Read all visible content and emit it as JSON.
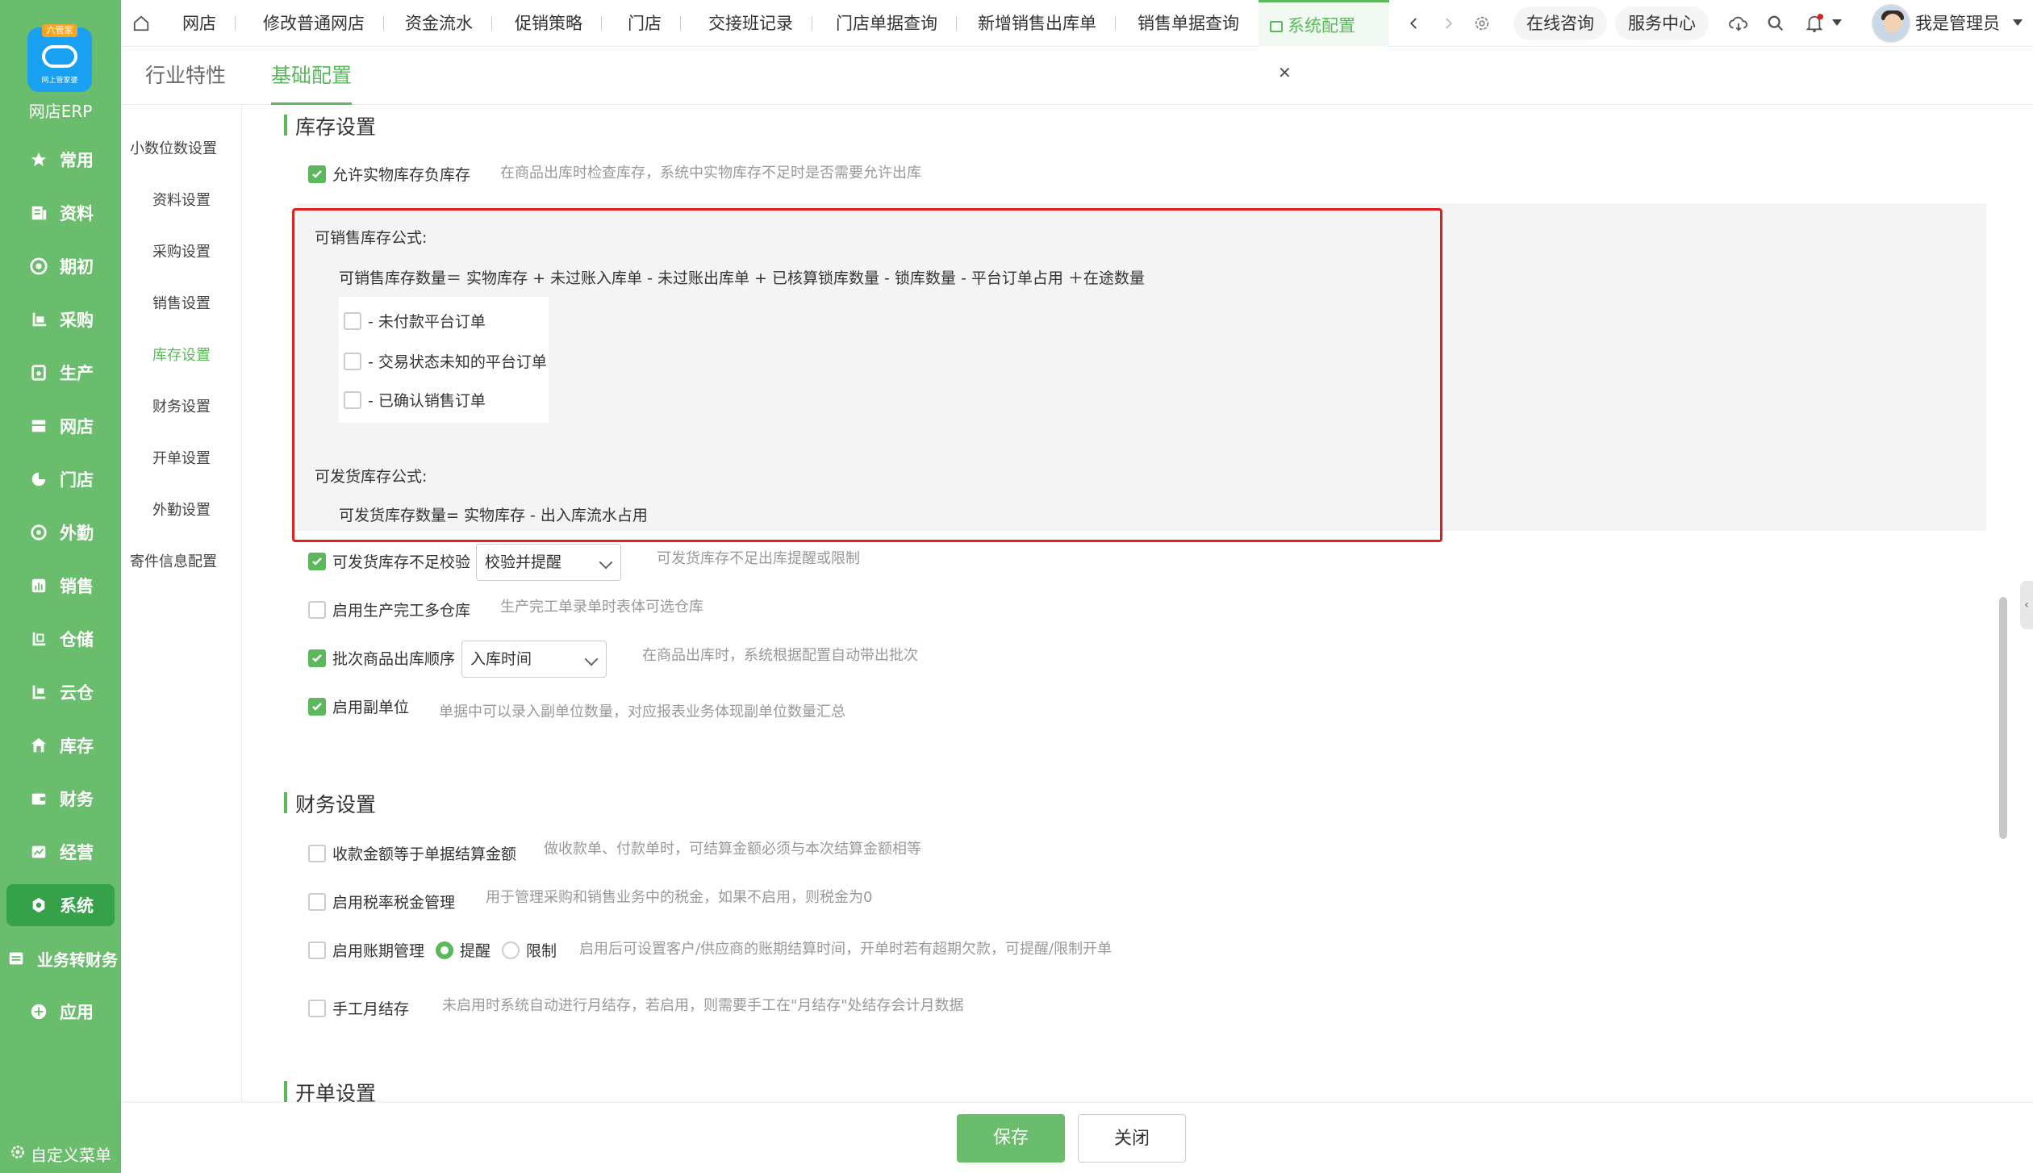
{
  "app": {
    "logo_tag": "六管家",
    "logo_sub": "网上管家婆",
    "name": "网店ERP"
  },
  "nav": [
    {
      "label": "常用",
      "icon": "star-icon"
    },
    {
      "label": "资料",
      "icon": "document-icon"
    },
    {
      "label": "期初",
      "icon": "target-icon"
    },
    {
      "label": "采购",
      "icon": "cart-icon"
    },
    {
      "label": "生产",
      "icon": "factory-icon"
    },
    {
      "label": "网店",
      "icon": "store-icon"
    },
    {
      "label": "门店",
      "icon": "shop-icon"
    },
    {
      "label": "外勤",
      "icon": "location-icon"
    },
    {
      "label": "销售",
      "icon": "chart-icon"
    },
    {
      "label": "仓储",
      "icon": "warehouse-icon"
    },
    {
      "label": "云仓",
      "icon": "cloud-warehouse-icon"
    },
    {
      "label": "库存",
      "icon": "inventory-icon"
    },
    {
      "label": "财务",
      "icon": "wallet-icon"
    },
    {
      "label": "经营",
      "icon": "business-icon"
    },
    {
      "label": "系统",
      "icon": "settings-icon"
    },
    {
      "label": "业务转财务",
      "icon": "transfer-icon"
    },
    {
      "label": "应用",
      "icon": "plus-circle-icon"
    }
  ],
  "customize_menu": "自定义菜单",
  "tabs": [
    "网店",
    "修改普通网店",
    "资金流水",
    "促销策略",
    "门店",
    "交接班记录",
    "门店单据查询",
    "新增销售出库单",
    "销售单据查询",
    "系统配置"
  ],
  "topbar": {
    "online_consult": "在线咨询",
    "service_center": "服务中心",
    "username": "我是管理员"
  },
  "subtabs": [
    "行业特性",
    "基础配置"
  ],
  "side_menu": [
    "小数位数设置",
    "资料设置",
    "采购设置",
    "销售设置",
    "库存设置",
    "财务设置",
    "开单设置",
    "外勤设置",
    "寄件信息配置"
  ],
  "inventory": {
    "title": "库存设置",
    "allow_negative": {
      "label": "允许实物库存负库存",
      "hint": "在商品出库时检查库存，系统中实物库存不足时是否需要允许出库"
    },
    "sellable_formula_title": "可销售库存公式:",
    "sellable_formula": "可销售库存数量＝ 实物库存 + 未过账入库单 - 未过账出库单 + 已核算锁库数量 - 锁库数量 - 平台订单占用 ＋在途数量",
    "options": [
      "- 未付款平台订单",
      "- 交易状态未知的平台订单",
      "- 已确认销售订单"
    ],
    "shippable_formula_title": "可发货库存公式:",
    "shippable_formula": "可发货库存数量= 实物库存 - 出入库流水占用",
    "shippable_check": {
      "label": "可发货库存不足校验",
      "value": "校验并提醒",
      "hint": "可发货库存不足出库提醒或限制"
    },
    "multi_warehouse": {
      "label": "启用生产完工多仓库",
      "hint": "生产完工单录单时表体可选仓库"
    },
    "batch_order": {
      "label": "批次商品出库顺序",
      "value": "入库时间",
      "hint": "在商品出库时，系统根据配置自动带出批次"
    },
    "sub_unit": {
      "label": "启用副单位",
      "hint": "单据中可以录入副单位数量，对应报表业务体现副单位数量汇总"
    }
  },
  "finance": {
    "title": "财务设置",
    "receipt_equal": {
      "label": "收款金额等于单据结算金额",
      "hint": "做收款单、付款单时，可结算金额必须与本次结算金额相等"
    },
    "tax": {
      "label": "启用税率税金管理",
      "hint": "用于管理采购和销售业务中的税金，如果不启用，则税金为0"
    },
    "payment_term": {
      "label": "启用账期管理",
      "radio_remind": "提醒",
      "radio_limit": "限制",
      "hint": "启用后可设置客户/供应商的账期结算时间，开单时若有超期欠款，可提醒/限制开单"
    },
    "monthly": {
      "label": "手工月结存",
      "hint": "未启用时系统自动进行月结存，若启用，则需要手工在\"月结存\"处结存会计月数据"
    }
  },
  "order": {
    "title": "开单设置"
  },
  "buttons": {
    "save": "保存",
    "close": "关闭"
  },
  "colors": {
    "accent": "#5cb85c",
    "nav_bg": "#6bbd6e",
    "highlight": "#e02020"
  }
}
